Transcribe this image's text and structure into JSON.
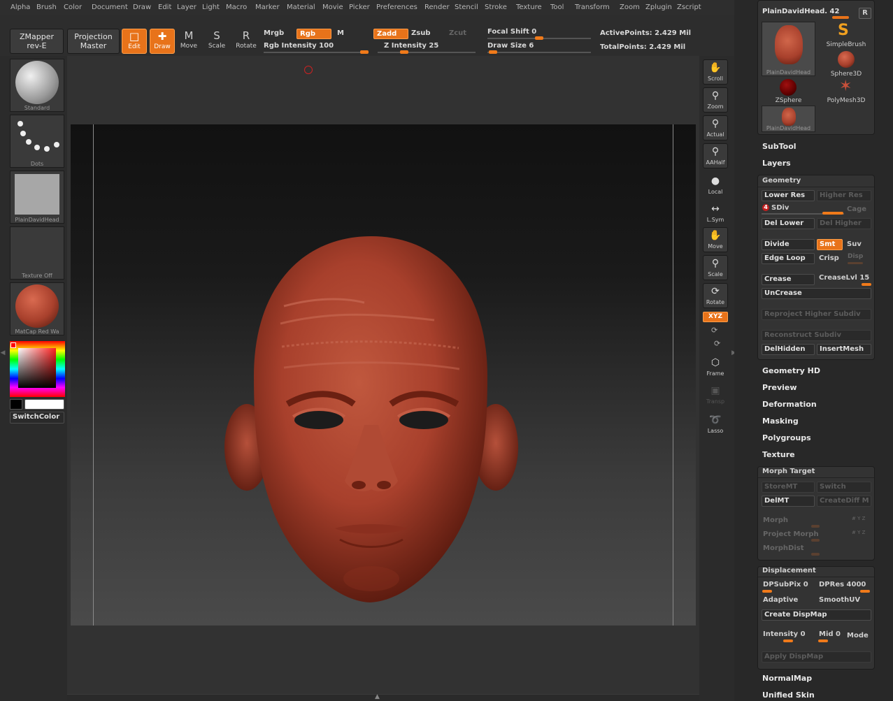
{
  "menu": [
    "Alpha",
    "Brush",
    "Color",
    "Document",
    "Draw",
    "Edit",
    "Layer",
    "Light",
    "Macro",
    "Marker",
    "Material",
    "Movie",
    "Picker",
    "Preferences",
    "Render",
    "Stencil",
    "Stroke",
    "Texture",
    "Tool",
    "Transform",
    "Zoom",
    "Zplugin",
    "Zscript"
  ],
  "toolbar": {
    "zmapper_l1": "ZMapper",
    "zmapper_l2": "rev-E",
    "projection_l1": "Projection",
    "projection_l2": "Master",
    "edit": "Edit",
    "draw": "Draw",
    "move": "Move",
    "scale": "Scale",
    "rotate": "Rotate",
    "mrgb": "Mrgb",
    "rgb": "Rgb",
    "m": "M",
    "rgb_intensity": "Rgb Intensity 100",
    "zadd": "Zadd",
    "zsub": "Zsub",
    "zcut": "Zcut",
    "z_intensity": "Z Intensity 25",
    "focal_shift": "Focal Shift 0",
    "draw_size": "Draw Size 6",
    "active_points": "ActivePoints: 2.429 Mil",
    "total_points": "TotalPoints: 2.429 Mil"
  },
  "slider_values": {
    "rgb_intensity": 100,
    "z_intensity": 25,
    "focal_shift": 0,
    "draw_size": 6
  },
  "left_shelf": {
    "brush": "Standard",
    "stroke": "Dots",
    "alpha": "PlainDavidHead",
    "texture": "Texture Off",
    "material": "MatCap Red Wa",
    "switch_color": "SwitchColor"
  },
  "right_toolbar": [
    "Scroll",
    "Zoom",
    "Actual",
    "AAHalf",
    "Local",
    "L.Sym",
    "Move",
    "Scale",
    "Rotate",
    "XYZ",
    "Frame",
    "Transp",
    "Lasso"
  ],
  "tool_panel": {
    "current_tool": "PlainDavidHead. 42",
    "r_button": "R",
    "tools": [
      "PlainDavidHead",
      "SimpleBrush",
      "Sphere3D",
      "ZSphere",
      "PolyMesh3D",
      "PlainDavidHead"
    ]
  },
  "sections": {
    "subtool": "SubTool",
    "layers": "Layers",
    "geometry": "Geometry",
    "geometry_hd": "Geometry HD",
    "preview": "Preview",
    "deformation": "Deformation",
    "masking": "Masking",
    "polygroups": "Polygroups",
    "texture": "Texture",
    "morph_target": "Morph Target",
    "displacement": "Displacement",
    "normalmap": "NormalMap",
    "unified_skin": "Unified Skin"
  },
  "geometry": {
    "lower_res": "Lower Res",
    "higher_res": "Higher Res",
    "sdiv_num": "4",
    "sdiv": "SDiv",
    "cage": "Cage",
    "del_lower": "Del Lower",
    "del_higher": "Del Higher",
    "divide": "Divide",
    "smt": "Smt",
    "suv": "Suv",
    "edge_loop": "Edge Loop",
    "crisp": "Crisp",
    "disp": "Disp",
    "crease": "Crease",
    "crease_lvl": "CreaseLvl 15",
    "uncrease": "UnCrease",
    "reproject": "Reproject Higher Subdiv",
    "reconstruct": "Reconstruct Subdiv",
    "delhidden": "DelHidden",
    "insertmesh": "InsertMesh"
  },
  "morph": {
    "storemt": "StoreMT",
    "switch": "Switch",
    "delmt": "DelMT",
    "creatediff": "CreateDiff M",
    "morph": "Morph",
    "project_morph": "Project Morph",
    "morphdist": "MorphDist",
    "xyz1": "# Y Z",
    "xyz2": "# Y Z"
  },
  "displacement": {
    "dpsubpix": "DPSubPix 0",
    "dpres": "DPRes 4000",
    "adaptive": "Adaptive",
    "smoothuv": "SmoothUV",
    "create": "Create DispMap",
    "intensity": "Intensity 0",
    "mid": "Mid 0",
    "mode": "Mode",
    "apply": "Apply DispMap"
  },
  "colors": {
    "accent": "#e8731a",
    "clay": "#a8402c"
  }
}
